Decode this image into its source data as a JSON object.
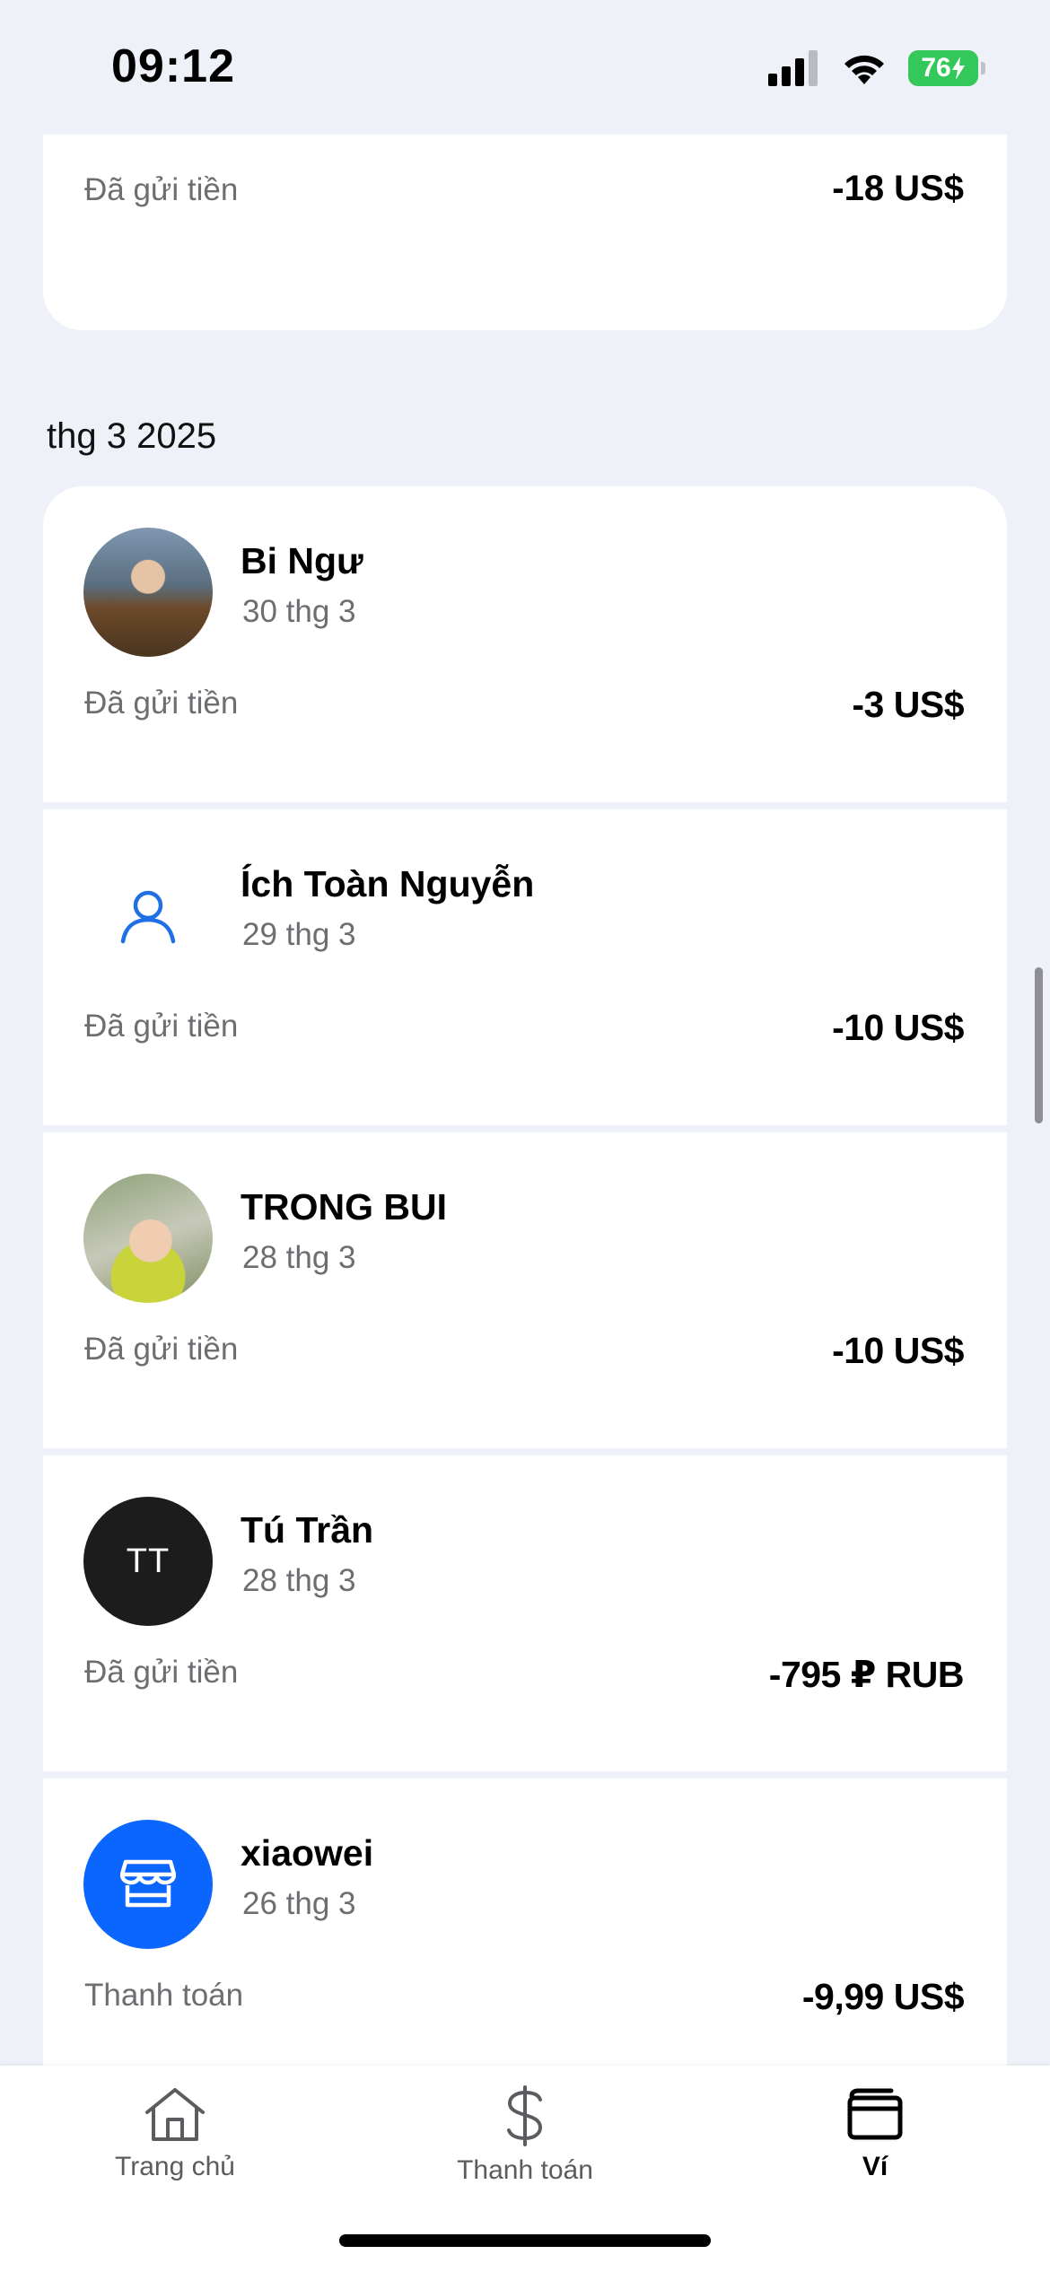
{
  "status_bar": {
    "time": "09:12",
    "battery": "76"
  },
  "previous_card": {
    "status": "Đã gửi tiền",
    "amount": "-18 US$"
  },
  "month_header": "thg 3 2025",
  "transactions": [
    {
      "name": "Bi Ngư",
      "date": "30 thg 3",
      "status": "Đã gửi tiền",
      "amount": "-3 US$",
      "avatar": "photo"
    },
    {
      "name": "Ích Toàn Nguyễn",
      "date": "29 thg 3",
      "status": "Đã gửi tiền",
      "amount": "-10 US$",
      "avatar": "person-icon"
    },
    {
      "name": "TRONG BUI",
      "date": "28 thg 3",
      "status": "Đã gửi tiền",
      "amount": "-10 US$",
      "avatar": "photo"
    },
    {
      "name": "Tú Trần",
      "date": "28 thg 3",
      "status": "Đã gửi tiền",
      "amount": "-795 ₽ RUB",
      "avatar": "initials",
      "initials": "TT"
    },
    {
      "name": "xiaowei",
      "date": "26 thg 3",
      "status": "Thanh toán",
      "amount": "-9,99 US$",
      "avatar": "store-icon"
    }
  ],
  "bottom_nav": {
    "items": [
      {
        "label": "Trang chủ",
        "icon": "home-icon"
      },
      {
        "label": "Thanh toán",
        "icon": "dollar-icon"
      },
      {
        "label": "Ví",
        "icon": "wallet-icon",
        "active": true
      }
    ]
  },
  "colors": {
    "background": "#eef2f8",
    "accent": "#0b66ff",
    "battery": "#34c759"
  }
}
